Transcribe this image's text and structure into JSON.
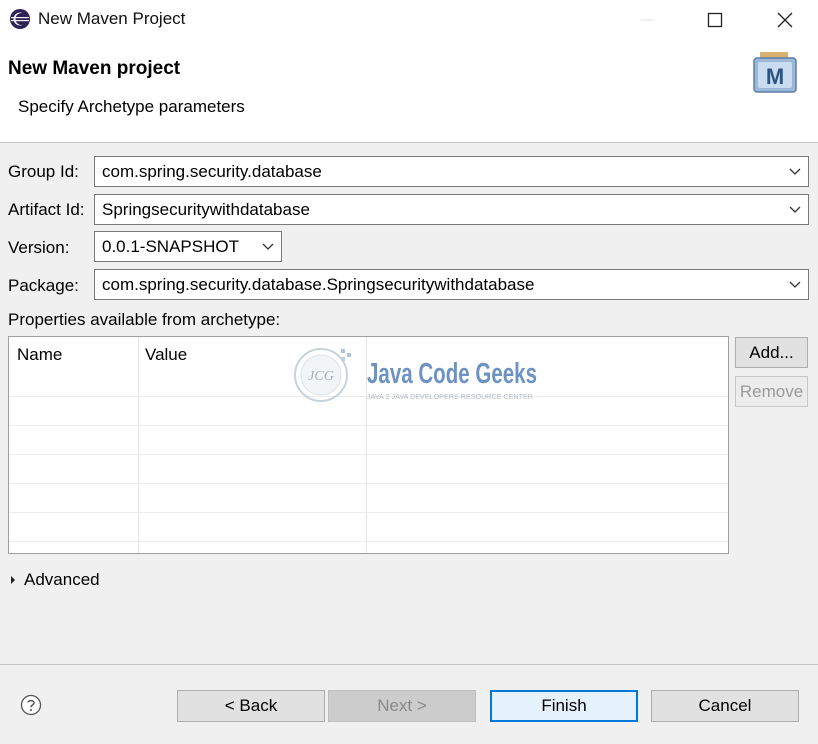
{
  "window": {
    "title": "New Maven Project",
    "controls": [
      "minimize-icon",
      "maximize-icon",
      "close-icon"
    ]
  },
  "header": {
    "title": "New Maven project",
    "description": "Specify Archetype parameters",
    "badge_letter": "M"
  },
  "form": {
    "group_id": {
      "label": "Group Id:",
      "value": "com.spring.security.database"
    },
    "artifact_id": {
      "label": "Artifact Id:",
      "value": "Springsecuritywithdatabase"
    },
    "version": {
      "label": "Version:",
      "value": "0.0.1-SNAPSHOT"
    },
    "package": {
      "label": "Package:",
      "value": "com.spring.security.database.Springsecuritywithdatabase"
    }
  },
  "properties": {
    "label": "Properties available from archetype:",
    "columns": [
      "Name",
      "Value"
    ],
    "rows": [],
    "watermark": {
      "initials": "JCG",
      "brand": "Java Code Geeks",
      "tagline": "JAVA 2 JAVA DEVELOPERS RESOURCE CENTER"
    },
    "add_label": "Add...",
    "remove_label": "Remove"
  },
  "advanced": {
    "label": "Advanced"
  },
  "footer": {
    "help_icon": "help-icon",
    "back_label": "< Back",
    "next_label": "Next >",
    "finish_label": "Finish",
    "cancel_label": "Cancel"
  }
}
